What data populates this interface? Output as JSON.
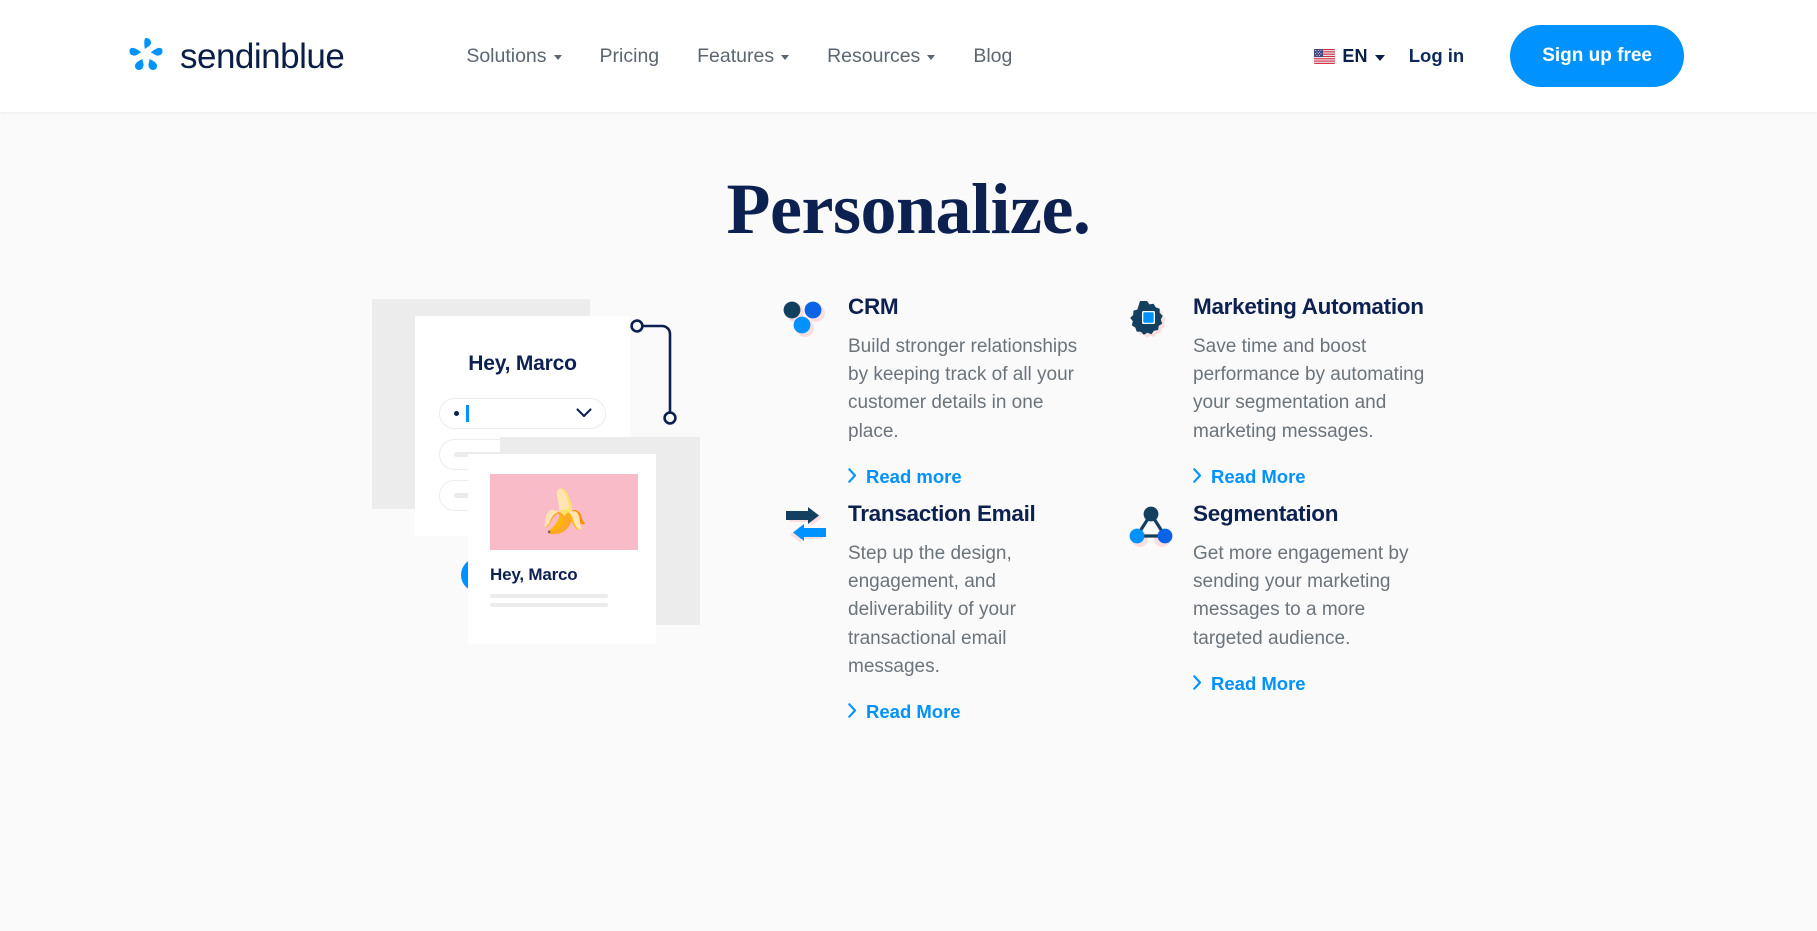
{
  "brand": {
    "name": "sendinblue",
    "logo_icon": "sendinblue-pinwheel-logo",
    "accent_blue": "#0092ff",
    "navy": "#0d2150",
    "pink": "#f9bbc8"
  },
  "header": {
    "nav": [
      {
        "label": "Solutions",
        "has_dropdown": true
      },
      {
        "label": "Pricing",
        "has_dropdown": false
      },
      {
        "label": "Features",
        "has_dropdown": true
      },
      {
        "label": "Resources",
        "has_dropdown": true
      },
      {
        "label": "Blog",
        "has_dropdown": false
      }
    ],
    "language": {
      "code": "EN",
      "flag": "us-flag-icon"
    },
    "login_label": "Log in",
    "signup_label": "Sign up free"
  },
  "main": {
    "title": "Personalize.",
    "illustration": {
      "form_card": {
        "greeting": "Hey, Marco",
        "fields": [
          {
            "state": "active",
            "value": ""
          },
          {
            "state": "placeholder",
            "value": ""
          },
          {
            "state": "placeholder",
            "value": ""
          }
        ]
      },
      "preview_card": {
        "image": "banana-on-pink",
        "title": "Hey, Marco"
      },
      "status_icon": "blue-check-circle"
    },
    "features": [
      {
        "icon": "crm-dots-icon",
        "title": "CRM",
        "description": "Build stronger relationships by keeping track of all your customer details in one place.",
        "link_label": "Read more"
      },
      {
        "icon": "gear-icon",
        "title": "Marketing Automation",
        "description": "Save time and boost performance by automating your segmentation and marketing messages.",
        "link_label": "Read More"
      },
      {
        "icon": "two-arrows-icon",
        "title": "Transaction Email",
        "description": "Step up the design, engagement, and deliverability of your transactional email messages.",
        "link_label": "Read More"
      },
      {
        "icon": "network-triangle-icon",
        "title": "Segmentation",
        "description": "Get more engagement by sending your marketing messages to a more targeted audience.",
        "link_label": "Read More"
      }
    ]
  }
}
